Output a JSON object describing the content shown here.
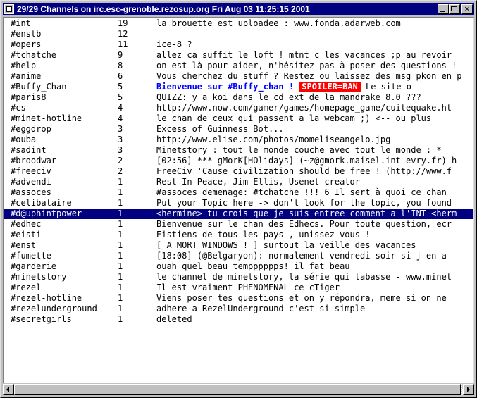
{
  "window": {
    "title": "29/29 Channels on irc.esc-grenoble.rezosup.org Fri Aug 03 11:25:15 2001",
    "controls": {
      "minimize": "minimize",
      "maximize": "maximize",
      "close": "×"
    }
  },
  "channels": [
    {
      "name": "#int",
      "users": "19",
      "topic": "la brouette est uploadee : www.fonda.adarweb.com"
    },
    {
      "name": "#enstb",
      "users": "12",
      "topic": ""
    },
    {
      "name": "#opers",
      "users": "11",
      "topic": "ice-8 ?"
    },
    {
      "name": "#tchatche",
      "users": "9",
      "topic": "allez ca suffit le loft ! mtnt c les vacances ;p au revoir"
    },
    {
      "name": "#help",
      "users": "8",
      "topic": "on est là pour aider, n'hésitez pas à poser des questions !"
    },
    {
      "name": "#anime",
      "users": "6",
      "topic": "Vous cherchez du stuff ? Restez ou laissez des msg pkon en p"
    },
    {
      "name": "#Buffy_Chan",
      "users": "5",
      "topic_parts": {
        "greeting": " Bienvenue sur #Buffy_chan ! ",
        "spoiler": "SPOILER=BAN",
        "rest": " Le site o"
      }
    },
    {
      "name": "#paris8",
      "users": "5",
      "topic": "QUIZZ: y a koi dans le cd ext de la mandrake 8.0 ???"
    },
    {
      "name": "#cs",
      "users": "4",
      "topic": "http://www.now.com/gamer/games/homepage_game/cuitequake.ht"
    },
    {
      "name": "#minet-hotline",
      "users": "4",
      "topic": "le chan de ceux qui passent a la webcam ;) <-- ou plus"
    },
    {
      "name": "#eggdrop",
      "users": "3",
      "topic": "Excess of Guinness Bot..."
    },
    {
      "name": "#ouba",
      "users": "3",
      "topic": "http://www.elise.com/photos/momeliseangelo.jpg"
    },
    {
      "name": "#sadint",
      "users": "3",
      "topic": "Minetstory : tout le monde couche avec tout le monde :  *"
    },
    {
      "name": "#broodwar",
      "users": "2",
      "topic": "[02:56] *** gMorK[HOlidays] (~z@gmork.maisel.int-evry.fr) h"
    },
    {
      "name": "#freeciv",
      "users": "2",
      "topic": "FreeCiv 'Cause civilization should be free ! (http://www.f"
    },
    {
      "name": "#advendi",
      "users": "1",
      "topic": "Rest In Peace, Jim Ellis, Usenet creator"
    },
    {
      "name": "#assoces",
      "users": "1",
      "topic": "#assoces demenage: #tchatche !!! 6 Il sert à quoi ce chan"
    },
    {
      "name": "#celibataire",
      "users": "1",
      "topic": "Put your Topic here -> don't look for the topic, you found"
    },
    {
      "name": "#d@uphintpower",
      "users": "1",
      "topic": "<hermine> tu crois que je suis entree comment a l'INT <herm",
      "selected": true
    },
    {
      "name": "#edhec",
      "users": "1",
      "topic": "Bienvenue sur le chan des Edhecs. Pour toute question, ecr"
    },
    {
      "name": "#eisti",
      "users": "1",
      "topic": "Eistiens de tous les pays , unissez vous !"
    },
    {
      "name": "#enst",
      "users": "1",
      "topic": "[ A MORT WINDOWS ! ] surtout la veille des vacances"
    },
    {
      "name": "#fumette",
      "users": "1",
      "topic": "[18:08] (@Belgaryon): normalement vendredi soir si j en a"
    },
    {
      "name": "#garderie",
      "users": "1",
      "topic": "ouah quel beau tempppppps! il fat beau"
    },
    {
      "name": "#minetstory",
      "users": "1",
      "topic": "le channel de minetstory, la série qui tabasse - www.minet"
    },
    {
      "name": "#rezel",
      "users": "1",
      "topic": "Il est vraiment PHENOMENAL ce cTiger"
    },
    {
      "name": "#rezel-hotline",
      "users": "1",
      "topic": "Viens poser tes questions et on y répondra, meme si on ne"
    },
    {
      "name": "#rezelunderground",
      "users": "1",
      "topic": "adhere a RezelUnderground c'est si simple"
    },
    {
      "name": "#secretgirls",
      "users": "1",
      "topic": "deleted"
    }
  ],
  "colors": {
    "titlebar": "#000080",
    "selection": "#000080",
    "topic_highlight": "#0000ff",
    "spoiler_bg": "#ff0000"
  }
}
